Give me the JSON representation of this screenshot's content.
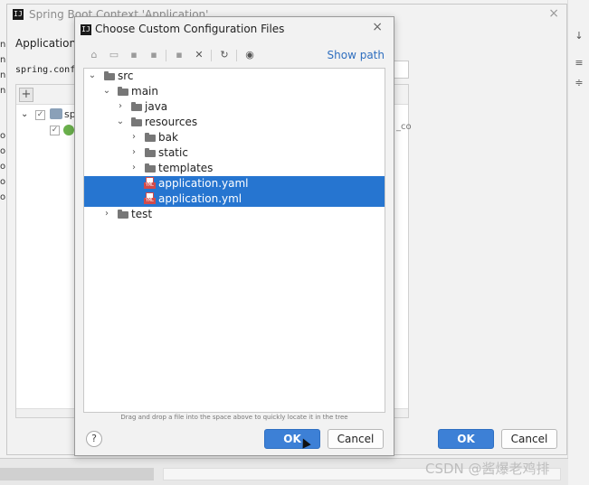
{
  "back_dialog": {
    "title": "Spring Boot Context 'Application'",
    "heading": "Application C",
    "config_label": "spring.confi",
    "tree_item": "sp",
    "tree_suffix": "_co",
    "ok_label": "OK",
    "cancel_label": "Cancel"
  },
  "ide": {
    "left_marks": [
      "n",
      "n",
      "n",
      "n",
      "o",
      "o",
      "o",
      "o",
      "o",
      "o"
    ],
    "right_icons": [
      "sort-icon",
      "expand-icon",
      "collapse-icon"
    ]
  },
  "dialog": {
    "title": "Choose Custom Configuration Files",
    "show_path": "Show path",
    "hint": "Drag and drop a file into the space above to quickly locate it in the tree",
    "ok_label": "OK",
    "cancel_label": "Cancel",
    "help": "?",
    "toolbar": [
      "home-icon",
      "desktop-icon",
      "project-icon",
      "module-icon",
      "new-folder-icon",
      "delete-icon",
      "refresh-icon",
      "show-hidden-icon"
    ]
  },
  "tree": [
    {
      "label": "src",
      "type": "folder",
      "expanded": true,
      "selected": false
    },
    {
      "label": "main",
      "type": "folder",
      "expanded": true,
      "selected": false
    },
    {
      "label": "java",
      "type": "folder",
      "expanded": false,
      "selected": false
    },
    {
      "label": "resources",
      "type": "folder",
      "expanded": true,
      "selected": false
    },
    {
      "label": "bak",
      "type": "folder",
      "expanded": false,
      "selected": false
    },
    {
      "label": "static",
      "type": "folder",
      "expanded": false,
      "selected": false
    },
    {
      "label": "templates",
      "type": "folder",
      "expanded": false,
      "selected": false
    },
    {
      "label": "application.yaml",
      "type": "yaml-file",
      "expanded": false,
      "selected": true
    },
    {
      "label": "application.yml",
      "type": "yaml-file",
      "expanded": false,
      "selected": true
    },
    {
      "label": "test",
      "type": "folder",
      "expanded": false,
      "selected": false
    }
  ],
  "colors": {
    "selection": "#2675d0",
    "primary_button": "#3d80d6",
    "link": "#2f6fbf"
  },
  "watermark": "CSDN @酱爆老鸡排"
}
